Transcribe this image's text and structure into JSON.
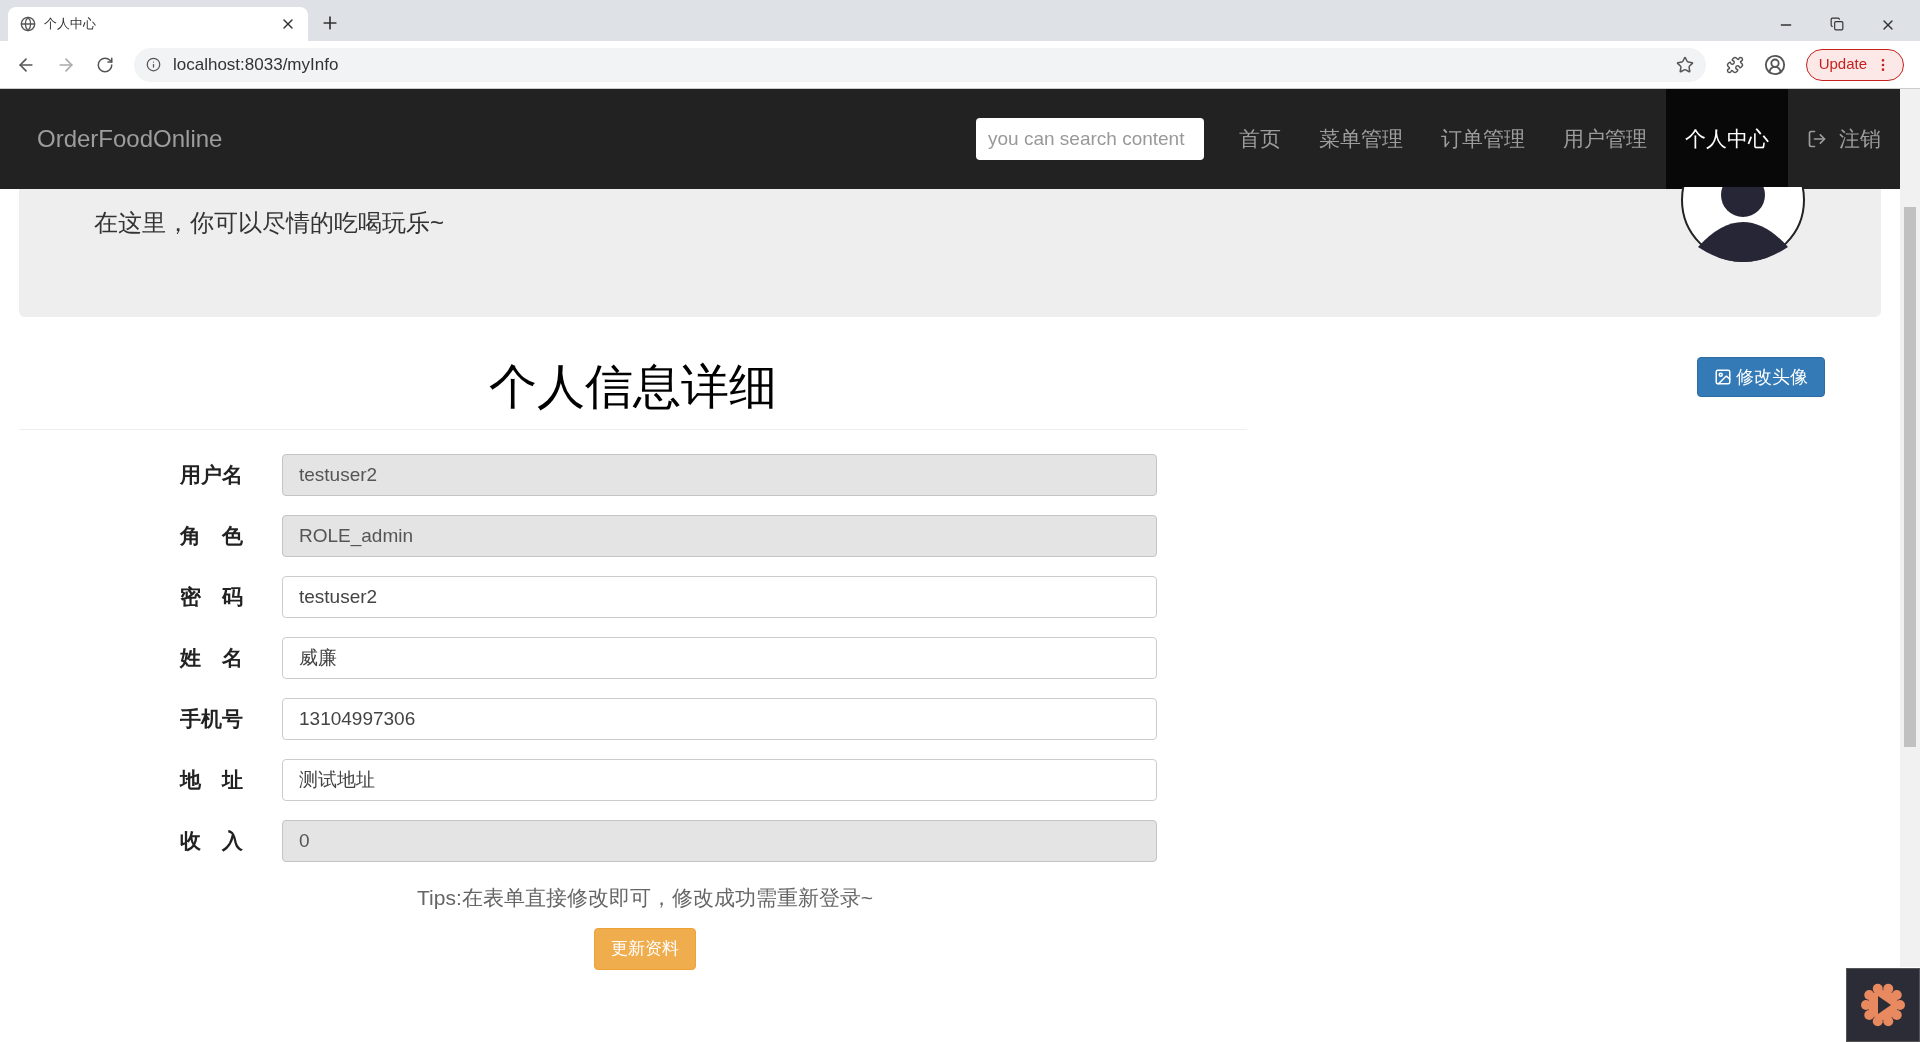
{
  "browser": {
    "tab_title": "个人中心",
    "url": "localhost:8033/myInfo",
    "update_button": "Update"
  },
  "navbar": {
    "brand": "OrderFoodOnline",
    "search": {
      "placeholder": "you can search content"
    },
    "items": [
      {
        "label": "首页",
        "selected": false
      },
      {
        "label": "菜单管理",
        "selected": false
      },
      {
        "label": "订单管理",
        "selected": false
      },
      {
        "label": "用户管理",
        "selected": false
      },
      {
        "label": "个人中心",
        "selected": true
      }
    ],
    "logout": "注销"
  },
  "banner": {
    "text": "在这里，你可以尽情的吃喝玩乐~"
  },
  "heading": "个人信息详细",
  "change_avatar_button": "修改头像",
  "form": [
    {
      "label": "用户名",
      "value": "testuser2",
      "disabled": true
    },
    {
      "label": "角　色",
      "value": "ROLE_admin",
      "disabled": true
    },
    {
      "label": "密　码",
      "value": "testuser2",
      "disabled": false
    },
    {
      "label": "姓　名",
      "value": "威廉",
      "disabled": false
    },
    {
      "label": "手机号",
      "value": "13104997306",
      "disabled": false
    },
    {
      "label": "地　址",
      "value": "测试地址",
      "disabled": false
    },
    {
      "label": "收　入",
      "value": "0",
      "disabled": true
    }
  ],
  "tips": "Tips:在表单直接修改即可，修改成功需重新登录~",
  "submit_button": "更新资料"
}
